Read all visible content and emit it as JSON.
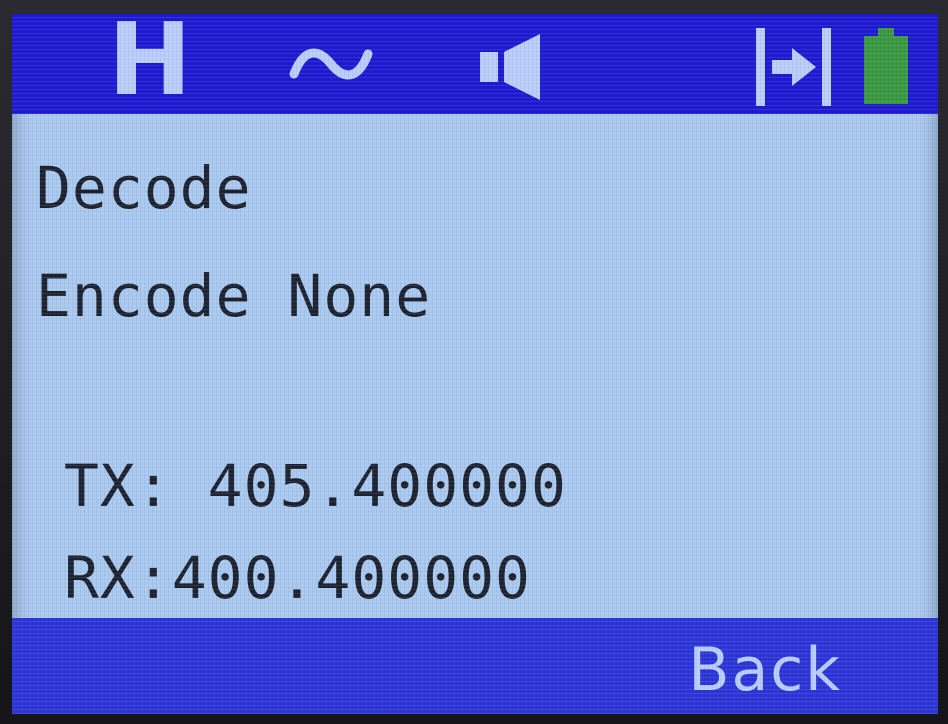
{
  "status_bar": {
    "channel_mode": "H",
    "icons": [
      "wave-icon",
      "speaker-icon",
      "signal-sync-icon",
      "battery-icon"
    ],
    "colors": {
      "bar": "#1e1ad2",
      "icon": "#b9cdfb",
      "battery": "#3a9a43"
    }
  },
  "content": {
    "decode_label": "Decode",
    "encode_line": "Encode None",
    "tx_line": "TX: 405.400000",
    "rx_line": "RX:400.400000"
  },
  "soft_keys": {
    "right_label": "Back"
  },
  "colors": {
    "screen_background": "#a9c8ef",
    "text": "#1c2230",
    "soft_bar": "#2b35d8"
  }
}
